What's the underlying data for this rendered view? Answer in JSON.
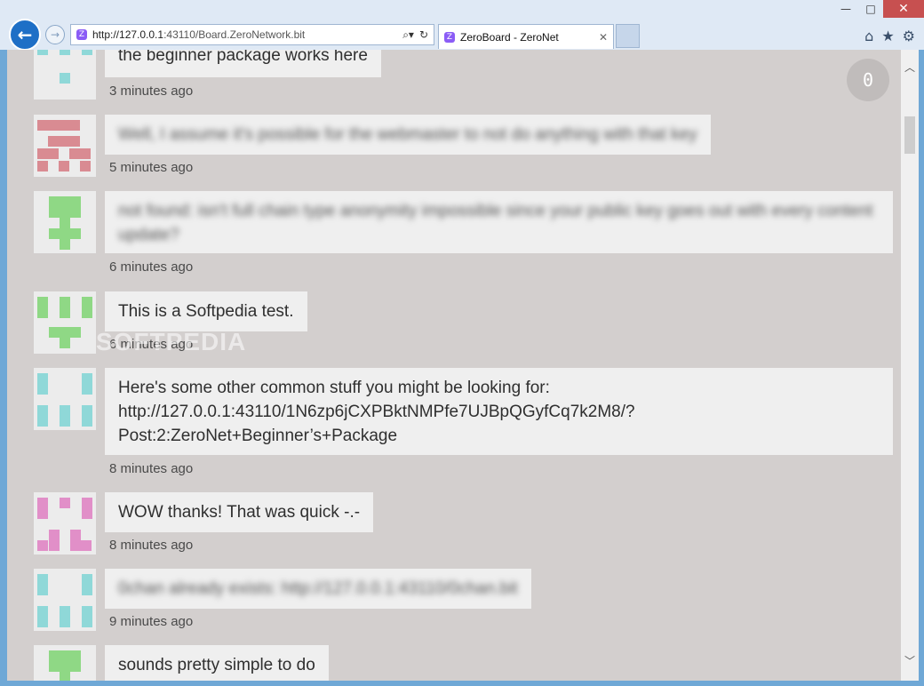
{
  "window": {
    "minimize_glyph": "—",
    "maximize_glyph": "□",
    "close_glyph": "✕"
  },
  "browser": {
    "back_glyph": "←",
    "forward_glyph": "→",
    "url_host": "http://127.0.0.1",
    "url_rest": ":43110/Board.ZeroNetwork.bit",
    "site_icon_glyph": "Z",
    "search_glyph": "⌕▾",
    "refresh_glyph": "↻",
    "tab_title": "ZeroBoard - ZeroNet",
    "tab_close_glyph": "✕",
    "home_glyph": "⌂",
    "favorites_glyph": "★",
    "settings_glyph": "⚙",
    "icons": [
      "back-icon",
      "forward-icon",
      "site-icon",
      "search-icon",
      "refresh-icon",
      "close-icon",
      "home-icon",
      "star-icon",
      "gear-icon"
    ]
  },
  "board": {
    "new_count": "0",
    "watermark": "SOFTPEDIA",
    "comments": [
      {
        "text": "the beginner package works here",
        "ago": "3 minutes ago",
        "avatar_color": "#8fd8d8",
        "blurred": false
      },
      {
        "text": "Well, I assume it's possible for the webmaster to not do anything with that key",
        "ago": "5 minutes ago",
        "avatar_color": "#d98b92",
        "blurred": true
      },
      {
        "text": "not found: isn't full chain type anonymity impossible since your public key goes out with every content update?",
        "ago": "6 minutes ago",
        "avatar_color": "#8fd885",
        "blurred": true
      },
      {
        "text": "This is a Softpedia test.",
        "ago": "6 minutes ago",
        "avatar_color": "#8fd885",
        "blurred": false
      },
      {
        "text": "Here's some other common stuff you might be looking for:",
        "text2": "http://127.0.0.1:43110/1N6zp6jCXPBktNMPfe7UJBpQGyfCq7k2M8/?",
        "text3": "Post:2:ZeroNet+Beginner’s+Package",
        "ago": "8 minutes ago",
        "avatar_color": "#8fd8d8",
        "blurred": false
      },
      {
        "text": "WOW thanks! That was quick -.-",
        "ago": "8 minutes ago",
        "avatar_color": "#e18fc8",
        "blurred": false
      },
      {
        "text": "0chan already exists: http://127.0.0.1:43110/0chan.bit",
        "ago": "9 minutes ago",
        "avatar_color": "#8fd8d8",
        "blurred": true
      },
      {
        "text": "sounds pretty simple to do",
        "ago": "",
        "avatar_color": "#8fd885",
        "blurred": false
      }
    ]
  },
  "scrollbar": {
    "up_glyph": "︿",
    "down_glyph": "﹀"
  }
}
